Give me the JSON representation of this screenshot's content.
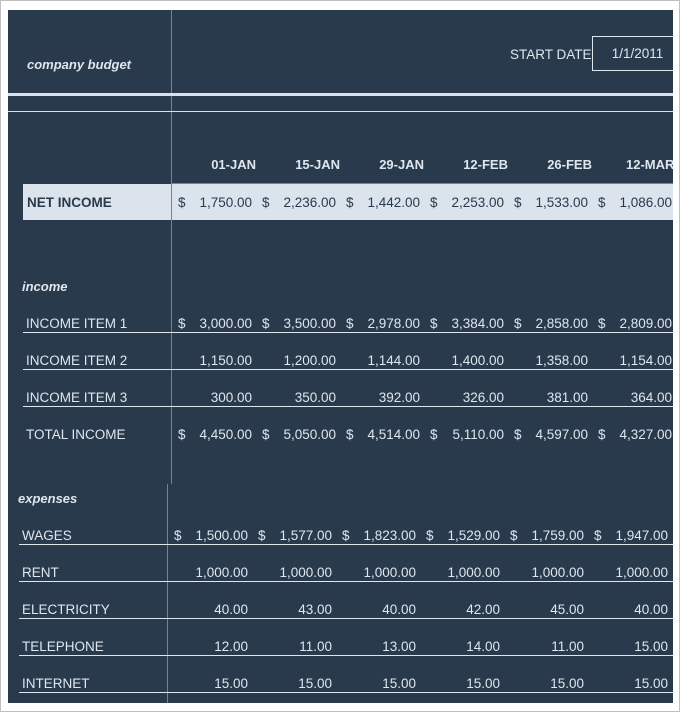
{
  "header": {
    "title": "company budget",
    "start_date_label": "START DATE",
    "start_date_value": "1/1/2011"
  },
  "columns": [
    "01-JAN",
    "15-JAN",
    "29-JAN",
    "12-FEB",
    "26-FEB",
    "12-MAR"
  ],
  "net_income": {
    "label": "NET INCOME",
    "currency": "$",
    "values": [
      "1,750.00",
      "2,236.00",
      "1,442.00",
      "2,253.00",
      "1,533.00",
      "1,086.00"
    ]
  },
  "income": {
    "section_label": "income",
    "rows": [
      {
        "label": "INCOME ITEM 1",
        "currency": "$",
        "values": [
          "3,000.00",
          "3,500.00",
          "2,978.00",
          "3,384.00",
          "2,858.00",
          "2,809.00"
        ]
      },
      {
        "label": "INCOME ITEM 2",
        "currency": "",
        "values": [
          "1,150.00",
          "1,200.00",
          "1,144.00",
          "1,400.00",
          "1,358.00",
          "1,154.00"
        ]
      },
      {
        "label": "INCOME ITEM 3",
        "currency": "",
        "values": [
          "300.00",
          "350.00",
          "392.00",
          "326.00",
          "381.00",
          "364.00"
        ]
      }
    ],
    "total": {
      "label": "TOTAL INCOME",
      "currency": "$",
      "values": [
        "4,450.00",
        "5,050.00",
        "4,514.00",
        "5,110.00",
        "4,597.00",
        "4,327.00"
      ]
    }
  },
  "expenses": {
    "section_label": "expenses",
    "rows": [
      {
        "label": "WAGES",
        "currency": "$",
        "values": [
          "1,500.00",
          "1,577.00",
          "1,823.00",
          "1,529.00",
          "1,759.00",
          "1,947.00"
        ]
      },
      {
        "label": "RENT",
        "currency": "",
        "values": [
          "1,000.00",
          "1,000.00",
          "1,000.00",
          "1,000.00",
          "1,000.00",
          "1,000.00"
        ]
      },
      {
        "label": "ELECTRICITY",
        "currency": "",
        "values": [
          "40.00",
          "43.00",
          "40.00",
          "42.00",
          "45.00",
          "40.00"
        ]
      },
      {
        "label": "TELEPHONE",
        "currency": "",
        "values": [
          "12.00",
          "11.00",
          "13.00",
          "14.00",
          "11.00",
          "15.00"
        ]
      },
      {
        "label": "INTERNET",
        "currency": "",
        "values": [
          "15.00",
          "15.00",
          "15.00",
          "15.00",
          "15.00",
          "15.00"
        ]
      }
    ]
  },
  "colors": {
    "background": "#293a4c",
    "highlight": "#dbe3ed",
    "text": "#dfe6ee"
  }
}
